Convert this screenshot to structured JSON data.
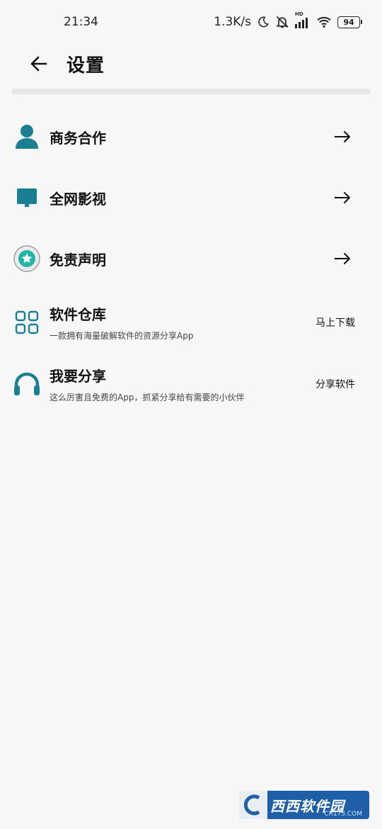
{
  "status_bar": {
    "time": "21:34",
    "net_speed": "1.3K/s",
    "hd_label": "HD",
    "battery": "94"
  },
  "header": {
    "title": "设置"
  },
  "menu": [
    {
      "label": "商务合作",
      "icon": "user-icon"
    },
    {
      "label": "全网影视",
      "icon": "monitor-icon"
    },
    {
      "label": "免责声明",
      "icon": "star-badge-icon"
    },
    {
      "label": "软件仓库",
      "desc": "一款拥有海量破解软件的资源分享App",
      "action": "马上下载",
      "icon": "grid-apps-icon"
    },
    {
      "label": "我要分享",
      "desc": "这么厉害且免费的App，抓紧分享给有需要的小伙伴",
      "action": "分享软件",
      "icon": "headphones-icon"
    }
  ],
  "watermark": {
    "text": "西西软件园",
    "sub": "CR173.COM"
  },
  "colors": {
    "icon_teal": "#1b7f93",
    "background": "#f7f7f7",
    "watermark_blue": "#1e5fa8"
  }
}
